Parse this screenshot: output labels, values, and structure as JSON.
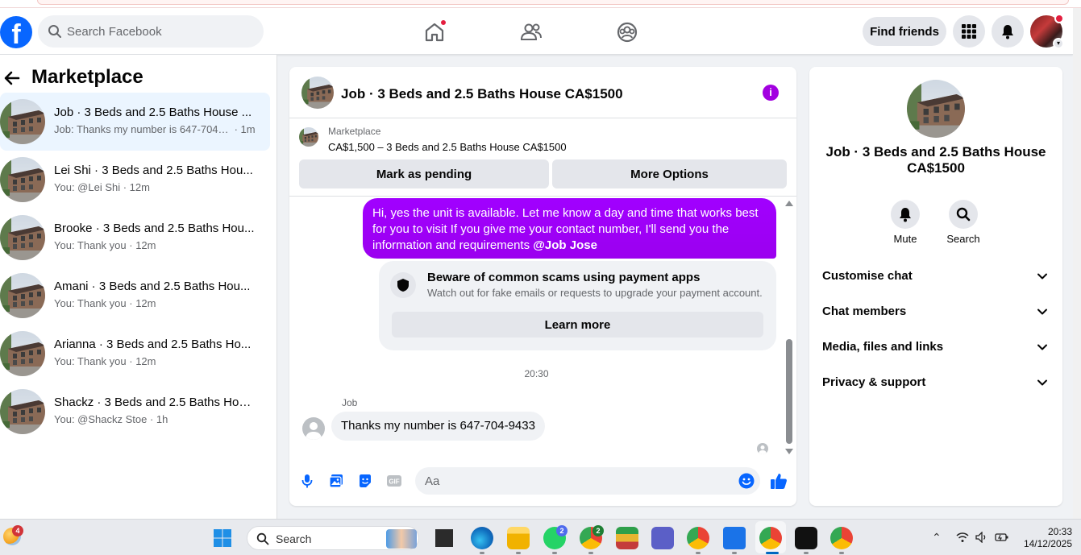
{
  "header": {
    "logo_letter": "f",
    "search_placeholder": "Search Facebook",
    "nav": [
      "home-icon",
      "friends-icon",
      "groups-icon"
    ],
    "find_friends": "Find friends"
  },
  "left": {
    "title": "Marketplace",
    "conversations": [
      {
        "title": "Job · 3 Beds and 2.5 Baths House ...",
        "preview": "Job: Thanks my number is 647-704-9...",
        "time": " · 1m",
        "active": true
      },
      {
        "title": "Lei Shi · 3 Beds and 2.5 Baths Hou...",
        "preview": "You: @Lei Shi",
        "time": " · 12m"
      },
      {
        "title": "Brooke · 3 Beds and 2.5 Baths Hou...",
        "preview": "You: Thank you",
        "time": " · 12m"
      },
      {
        "title": "Amani · 3 Beds and 2.5 Baths Hou...",
        "preview": "You: Thank you",
        "time": " · 12m"
      },
      {
        "title": "Arianna · 3 Beds and 2.5 Baths Ho...",
        "preview": "You: Thank you",
        "time": " · 12m"
      },
      {
        "title": "Shackz · 3 Beds and 2.5 Baths Hou...",
        "preview": "You: @Shackz Stoe",
        "time": " · 1h"
      }
    ]
  },
  "chat": {
    "title": "Job · 3 Beds and 2.5 Baths House CA$1500",
    "listing": {
      "label": "Marketplace",
      "price_line": "CA$1,500 – 3 Beds and 2.5 Baths House CA$1500",
      "mark_pending": "Mark as pending",
      "more_options": "More Options"
    },
    "outgoing": {
      "text": "Hi, yes the unit is available. Let me know a day and time that works best for you to visit If you give me your contact number, I'll send you the information and requirements ",
      "mention": "@Job Jose"
    },
    "warning": {
      "title": "Beware of common scams using payment apps",
      "text": "Watch out for fake emails or requests to upgrade your payment account.",
      "button": "Learn more"
    },
    "timestamp": "20:30",
    "incoming": {
      "sender": "Job",
      "text": "Thanks my number is 647-704-9433"
    },
    "composer_placeholder": "Aa"
  },
  "right": {
    "title": "Job · 3 Beds and 2.5 Baths House CA$1500",
    "actions": [
      {
        "label": "Mute",
        "icon": "bell-icon"
      },
      {
        "label": "Search",
        "icon": "search-icon"
      }
    ],
    "sections": [
      "Customise chat",
      "Chat members",
      "Media, files and links",
      "Privacy & support"
    ]
  },
  "taskbar": {
    "weather_badge": "4",
    "search_label": "Search",
    "whatsapp_badge": "2",
    "chrome_badge": "2",
    "time": "20:33",
    "date": "14/12/2025"
  },
  "colors": {
    "accent": "#0866ff",
    "bubble": "#a100ff",
    "notification": "#e41e3f"
  }
}
